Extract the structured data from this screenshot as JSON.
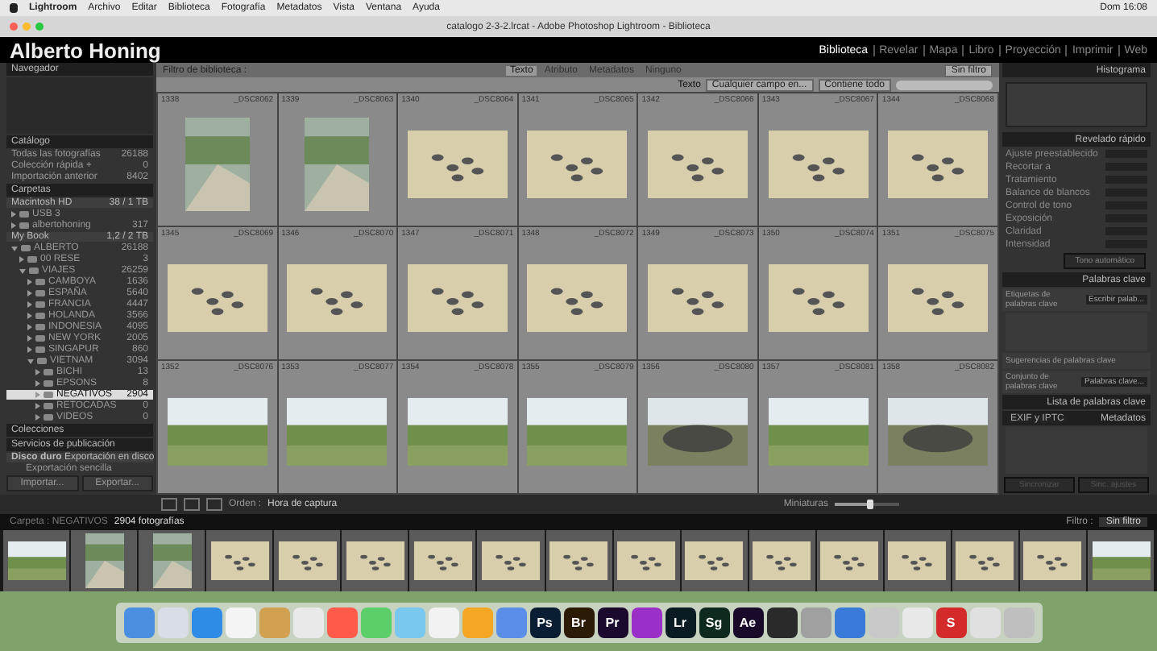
{
  "menu_bar": {
    "app": "Lightroom",
    "items": [
      "Archivo",
      "Editar",
      "Biblioteca",
      "Fotografía",
      "Metadatos",
      "Vista",
      "Ventana",
      "Ayuda"
    ],
    "clock": "Dom 16:08"
  },
  "window": {
    "title": "catalogo 2-3-2.lrcat - Adobe Photoshop Lightroom - Biblioteca"
  },
  "identity": {
    "name": "Alberto Honing",
    "modules": [
      {
        "label": "Biblioteca",
        "selected": true
      },
      {
        "label": "Revelar",
        "selected": false
      },
      {
        "label": "Mapa",
        "selected": false
      },
      {
        "label": "Libro",
        "selected": false
      },
      {
        "label": "Proyección",
        "selected": false
      },
      {
        "label": "Imprimir",
        "selected": false
      },
      {
        "label": "Web",
        "selected": false
      }
    ]
  },
  "left_panel": {
    "navigator": "Navegador",
    "catalog": {
      "title": "Catálogo",
      "rows": [
        {
          "label": "Todas las fotografías",
          "count": "26188"
        },
        {
          "label": "Colección rápida +",
          "count": "0"
        },
        {
          "label": "Importación anterior",
          "count": "8402"
        }
      ]
    },
    "folders": {
      "title": "Carpetas",
      "volumes": [
        {
          "label": "Macintosh HD",
          "info": "38 / 1 TB"
        },
        {
          "label": "My Book",
          "info": "1,2 / 2 TB"
        }
      ],
      "tree": [
        {
          "label": "USB 3",
          "expanded": false,
          "selected": false
        },
        {
          "label": "albertohoning",
          "count": "317",
          "expanded": false,
          "selected": false
        },
        {
          "label": "ALBERTO",
          "count": "26188",
          "expanded": true,
          "selected": false,
          "children": [
            {
              "label": "00 RESE",
              "count": "3",
              "expanded": false,
              "selected": false
            },
            {
              "label": "VIAJES",
              "count": "26259",
              "expanded": true,
              "selected": false,
              "children": [
                {
                  "label": "CAMBOYA",
                  "count": "1636",
                  "expanded": false,
                  "selected": false
                },
                {
                  "label": "ESPAÑA",
                  "count": "5640",
                  "expanded": false,
                  "selected": false
                },
                {
                  "label": "FRANCIA",
                  "count": "4447",
                  "expanded": false,
                  "selected": false
                },
                {
                  "label": "HOLANDA",
                  "count": "3566",
                  "expanded": false,
                  "selected": false
                },
                {
                  "label": "INDONESIA",
                  "count": "4095",
                  "expanded": false,
                  "selected": false
                },
                {
                  "label": "NEW YORK",
                  "count": "2005",
                  "expanded": false,
                  "selected": false
                },
                {
                  "label": "SINGAPUR",
                  "count": "860",
                  "expanded": false,
                  "selected": false
                },
                {
                  "label": "VIETNAM",
                  "count": "3094",
                  "expanded": true,
                  "selected": false,
                  "children": [
                    {
                      "label": "BICHI",
                      "count": "13",
                      "expanded": false,
                      "selected": false
                    },
                    {
                      "label": "EPSONS",
                      "count": "8",
                      "expanded": false,
                      "selected": false
                    },
                    {
                      "label": "NEGATIVOS",
                      "count": "2904",
                      "expanded": false,
                      "selected": true
                    },
                    {
                      "label": "RETOCADAS",
                      "count": "0",
                      "expanded": false,
                      "selected": false
                    },
                    {
                      "label": "VIDEOS",
                      "count": "0",
                      "expanded": false,
                      "selected": false
                    }
                  ]
                }
              ]
            }
          ]
        }
      ]
    },
    "collections": "Colecciones",
    "publish": {
      "title": "Servicios de publicación",
      "service": "Disco duro",
      "service_note": "Exportación en disco",
      "setup": "Exportación sencilla"
    },
    "buttons": [
      "Importar...",
      "Exportar..."
    ]
  },
  "filter_bar": {
    "label": "Filtro de biblioteca :",
    "tabs": [
      {
        "label": "Texto",
        "selected": true
      },
      {
        "label": "Atributo",
        "selected": false
      },
      {
        "label": "Metadatos",
        "selected": false
      },
      {
        "label": "Ninguno",
        "selected": false
      }
    ],
    "preset": "Sin filtro",
    "text_label": "Texto",
    "field_menu": "Cualquier campo en...",
    "rule_menu": "Contiene todo"
  },
  "grid": [
    {
      "index": "1338",
      "file": "_DSC8062",
      "kind": "river-portrait"
    },
    {
      "index": "1339",
      "file": "_DSC8063",
      "kind": "river-portrait"
    },
    {
      "index": "1340",
      "file": "_DSC8064",
      "kind": "sand"
    },
    {
      "index": "1341",
      "file": "_DSC8065",
      "kind": "sand"
    },
    {
      "index": "1342",
      "file": "_DSC8066",
      "kind": "sand"
    },
    {
      "index": "1343",
      "file": "_DSC8067",
      "kind": "sand"
    },
    {
      "index": "1344",
      "file": "_DSC8068",
      "kind": "sand"
    },
    {
      "index": "1345",
      "file": "_DSC8069",
      "kind": "sand"
    },
    {
      "index": "1346",
      "file": "_DSC8070",
      "kind": "sand"
    },
    {
      "index": "1347",
      "file": "_DSC8071",
      "kind": "sand"
    },
    {
      "index": "1348",
      "file": "_DSC8072",
      "kind": "sand"
    },
    {
      "index": "1349",
      "file": "_DSC8073",
      "kind": "sand"
    },
    {
      "index": "1350",
      "file": "_DSC8074",
      "kind": "sand"
    },
    {
      "index": "1351",
      "file": "_DSC8075",
      "kind": "sand"
    },
    {
      "index": "1352",
      "file": "_DSC8076",
      "kind": "landscape"
    },
    {
      "index": "1353",
      "file": "_DSC8077",
      "kind": "landscape"
    },
    {
      "index": "1354",
      "file": "_DSC8078",
      "kind": "landscape"
    },
    {
      "index": "1355",
      "file": "_DSC8079",
      "kind": "landscape"
    },
    {
      "index": "1356",
      "file": "_DSC8080",
      "kind": "wreck"
    },
    {
      "index": "1357",
      "file": "_DSC8081",
      "kind": "landscape"
    },
    {
      "index": "1358",
      "file": "_DSC8082",
      "kind": "wreck"
    }
  ],
  "toolbar": {
    "sort_label": "Orden :",
    "sort_value": "Hora de captura",
    "thumb_label": "Miniaturas",
    "thumb": {
      "level": 0.55
    }
  },
  "right_panel": {
    "histogram": "Histograma",
    "quick_develop": {
      "title": "Revelado rápido",
      "rows": [
        "Ajuste preestablecido",
        "Recortar a",
        "Tratamiento",
        "Balance de blancos",
        "Control de tono",
        "Exposición",
        "Claridad",
        "Intensidad"
      ],
      "auto_button": "Tono automático"
    },
    "keywording": {
      "title": "Palabras clave",
      "tags_label": "Etiquetas de palabras clave",
      "tags_menu": "Escribir palab...",
      "suggest_label": "Sugerencias de palabras clave",
      "set_label": "Conjunto de palabras clave",
      "set_menu": "Palabras clave..."
    },
    "keyword_list": "Lista de palabras clave",
    "metadata": {
      "title": "Metadatos",
      "preset": "EXIF y IPTC"
    },
    "buttons": [
      {
        "label": "Sincronizar",
        "disabled": true
      },
      {
        "label": "Sinc. ajustes",
        "disabled": true
      }
    ]
  },
  "filmstrip": {
    "source_prefix": "Carpeta : NEGATIVOS",
    "count": "2904 fotografías",
    "filter_label": "Filtro :",
    "filter_value": "Sin filtro",
    "thumbs": [
      {
        "kind": "landscape"
      },
      {
        "kind": "river-portrait"
      },
      {
        "kind": "river-portrait"
      },
      {
        "kind": "sand"
      },
      {
        "kind": "sand"
      },
      {
        "kind": "sand"
      },
      {
        "kind": "sand"
      },
      {
        "kind": "sand"
      },
      {
        "kind": "sand"
      },
      {
        "kind": "sand"
      },
      {
        "kind": "sand"
      },
      {
        "kind": "sand"
      },
      {
        "kind": "sand"
      },
      {
        "kind": "sand"
      },
      {
        "kind": "sand"
      },
      {
        "kind": "sand"
      },
      {
        "kind": "landscape"
      }
    ]
  },
  "dock": [
    {
      "color": "#4a8fe0"
    },
    {
      "color": "#d8dde6"
    },
    {
      "color": "#2f8ce6"
    },
    {
      "color": "#f4f4f4"
    },
    {
      "color": "#d1a050"
    },
    {
      "color": "#e9e9e9"
    },
    {
      "color": "#ff5a4a"
    },
    {
      "color": "#5dcf6a"
    },
    {
      "color": "#7ac8f0"
    },
    {
      "color": "#f2f2f2"
    },
    {
      "color": "#f5a623"
    },
    {
      "color": "#5a8ee8"
    },
    {
      "color": "#0a1e33",
      "label": "Ps"
    },
    {
      "color": "#2b1b05",
      "label": "Br"
    },
    {
      "color": "#1c0a2e",
      "label": "Pr"
    },
    {
      "color": "#9b30c8"
    },
    {
      "color": "#0b1b24",
      "label": "Lr"
    },
    {
      "color": "#0e2a1e",
      "label": "Sg"
    },
    {
      "color": "#1a0a2a",
      "label": "Ae"
    },
    {
      "color": "#2a2a2a"
    },
    {
      "color": "#a0a0a0"
    },
    {
      "color": "#3a7ad8"
    },
    {
      "color": "#c8c8c8"
    },
    {
      "color": "#e8e8e8"
    },
    {
      "color": "#d42a2a",
      "label": "S"
    },
    {
      "color": "#e0e0e0"
    },
    {
      "color": "#bfbfbf"
    }
  ]
}
